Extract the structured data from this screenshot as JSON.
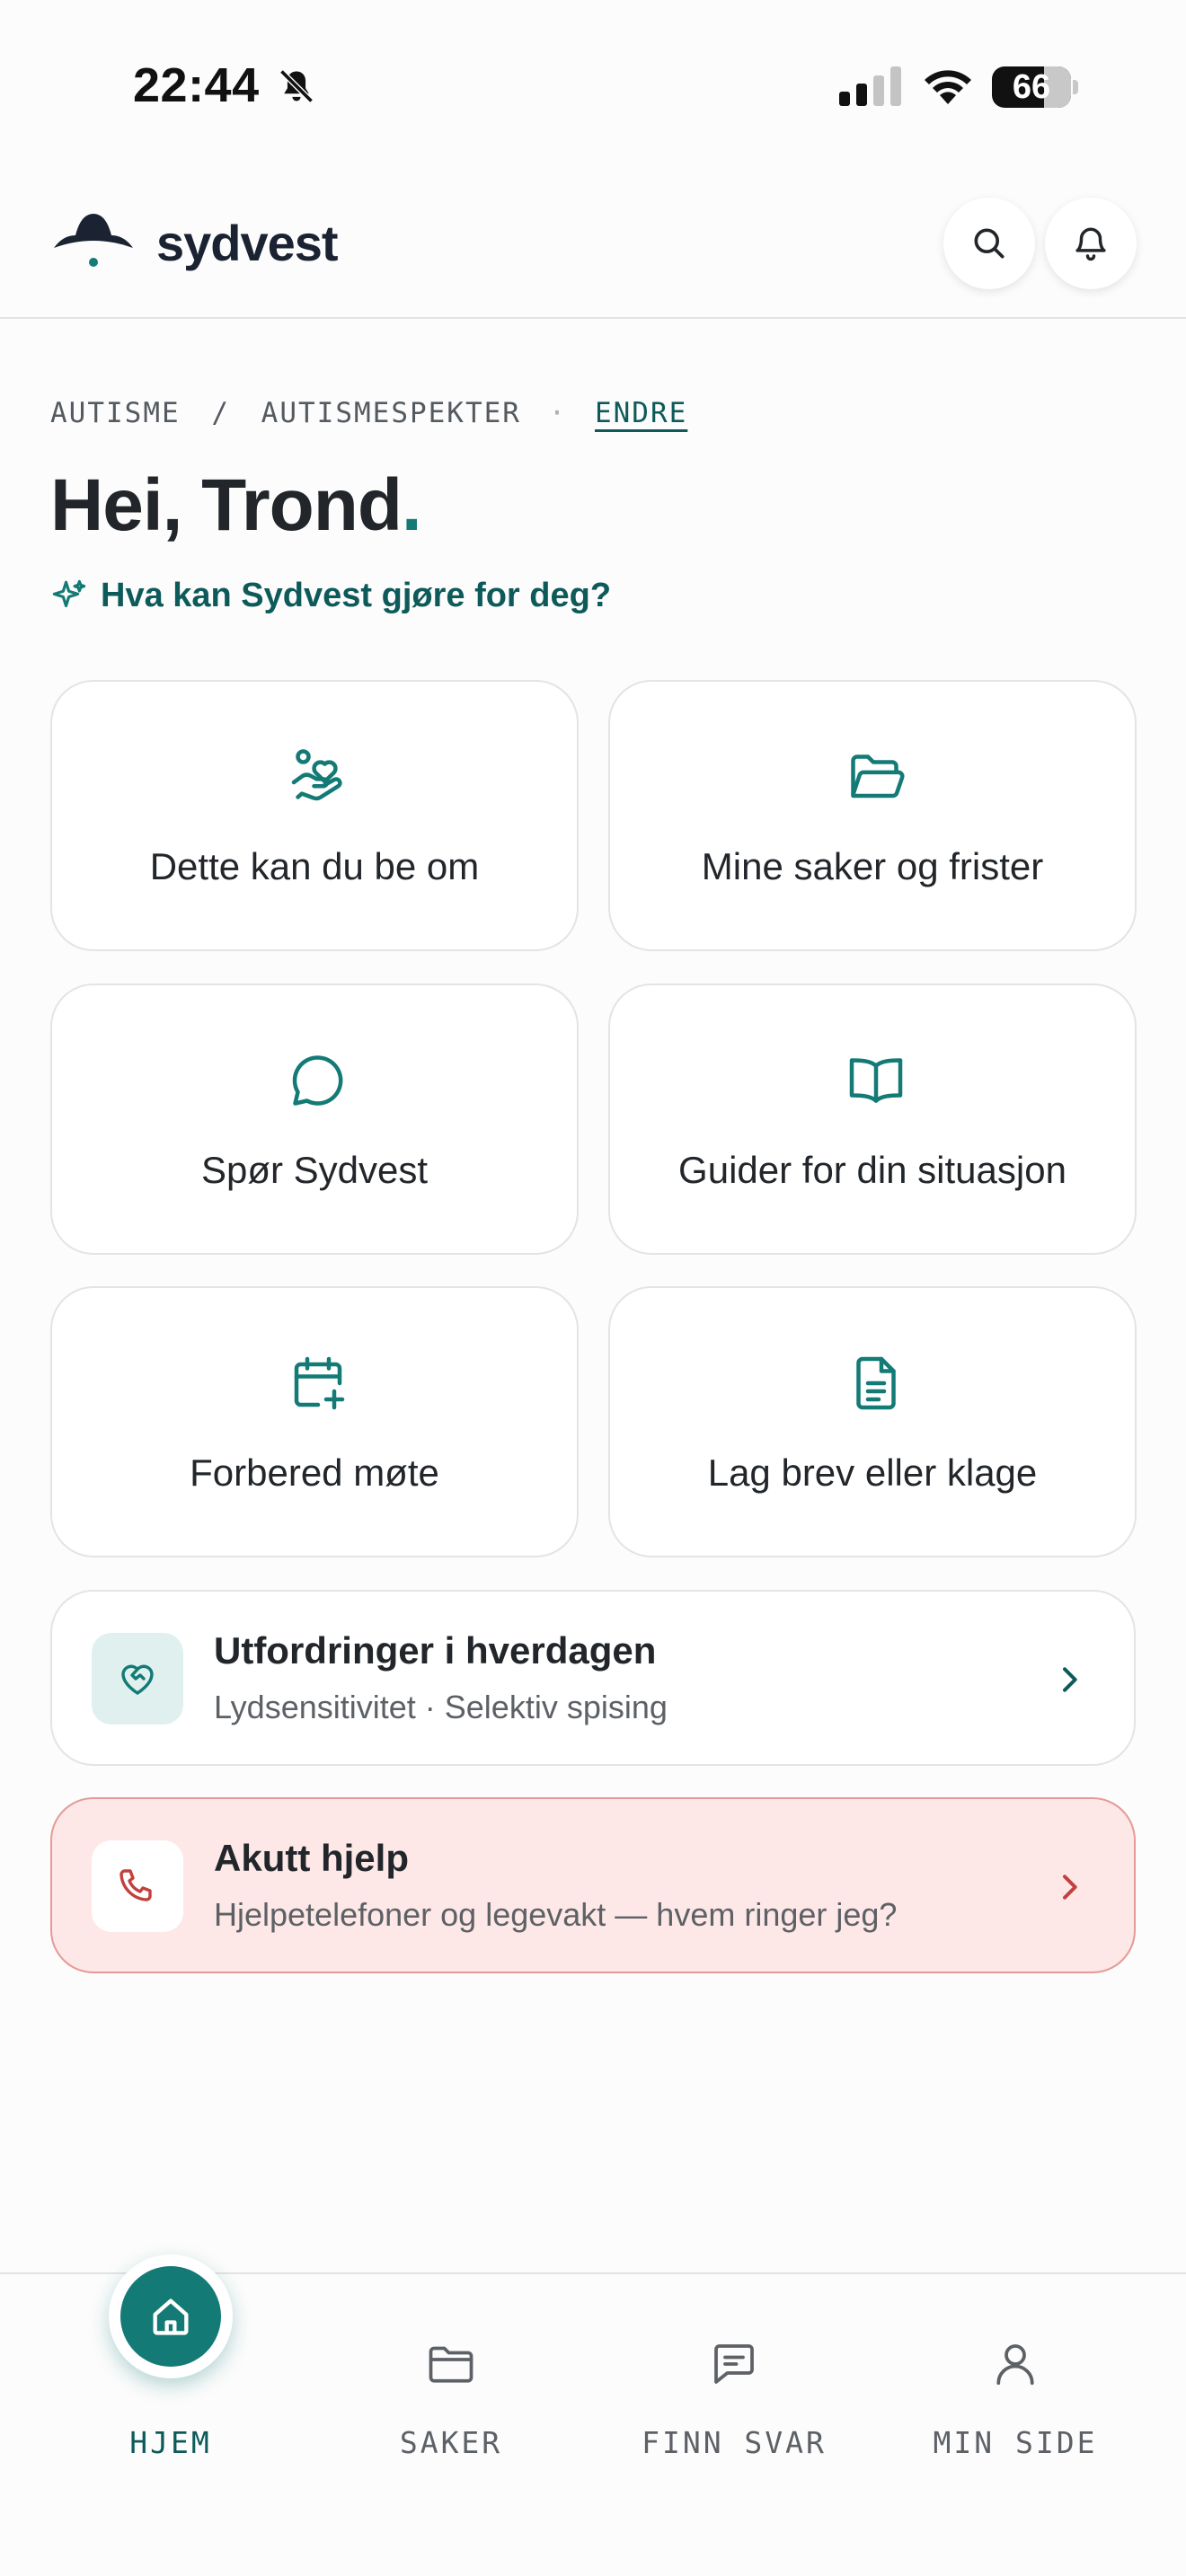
{
  "status_bar": {
    "time": "22:44",
    "battery": "66"
  },
  "header": {
    "brand": "sydvest"
  },
  "context": {
    "diagnosis": "AUTISME",
    "subtype": "AUTISMESPEKTER",
    "separator": "/",
    "edit": "ENDRE"
  },
  "greeting": {
    "text": "Hei, Trond",
    "punct": "."
  },
  "assistant_link": "Hva kan Sydvest gjøre for deg?",
  "tiles": [
    {
      "label": "Dette kan du be om",
      "icon": "hand-heart-icon"
    },
    {
      "label": "Mine saker og frister",
      "icon": "folder-open-icon"
    },
    {
      "label": "Spør Sydvest",
      "icon": "chat-bubble-icon"
    },
    {
      "label": "Guider for din situasjon",
      "icon": "open-book-icon"
    },
    {
      "label": "Forbered møte",
      "icon": "calendar-plus-icon"
    },
    {
      "label": "Lag brev eller klage",
      "icon": "document-icon"
    }
  ],
  "cards": {
    "challenges": {
      "title": "Utfordringer i hverdagen",
      "subtitle": "Lydsensitivitet · Selektiv spising"
    },
    "acute": {
      "title": "Akutt hjelp",
      "subtitle": "Hjelpetelefoner og legevakt — hvem ringer jeg?"
    }
  },
  "nav": [
    {
      "label": "HJEM",
      "active": true
    },
    {
      "label": "SAKER",
      "active": false
    },
    {
      "label": "FINN SVAR",
      "active": false
    },
    {
      "label": "MIN SIDE",
      "active": false
    }
  ],
  "colors": {
    "accent": "#147a76",
    "accent_dark": "#0e5a5a",
    "danger": "#c2413c",
    "danger_bg": "#fde8e7"
  }
}
